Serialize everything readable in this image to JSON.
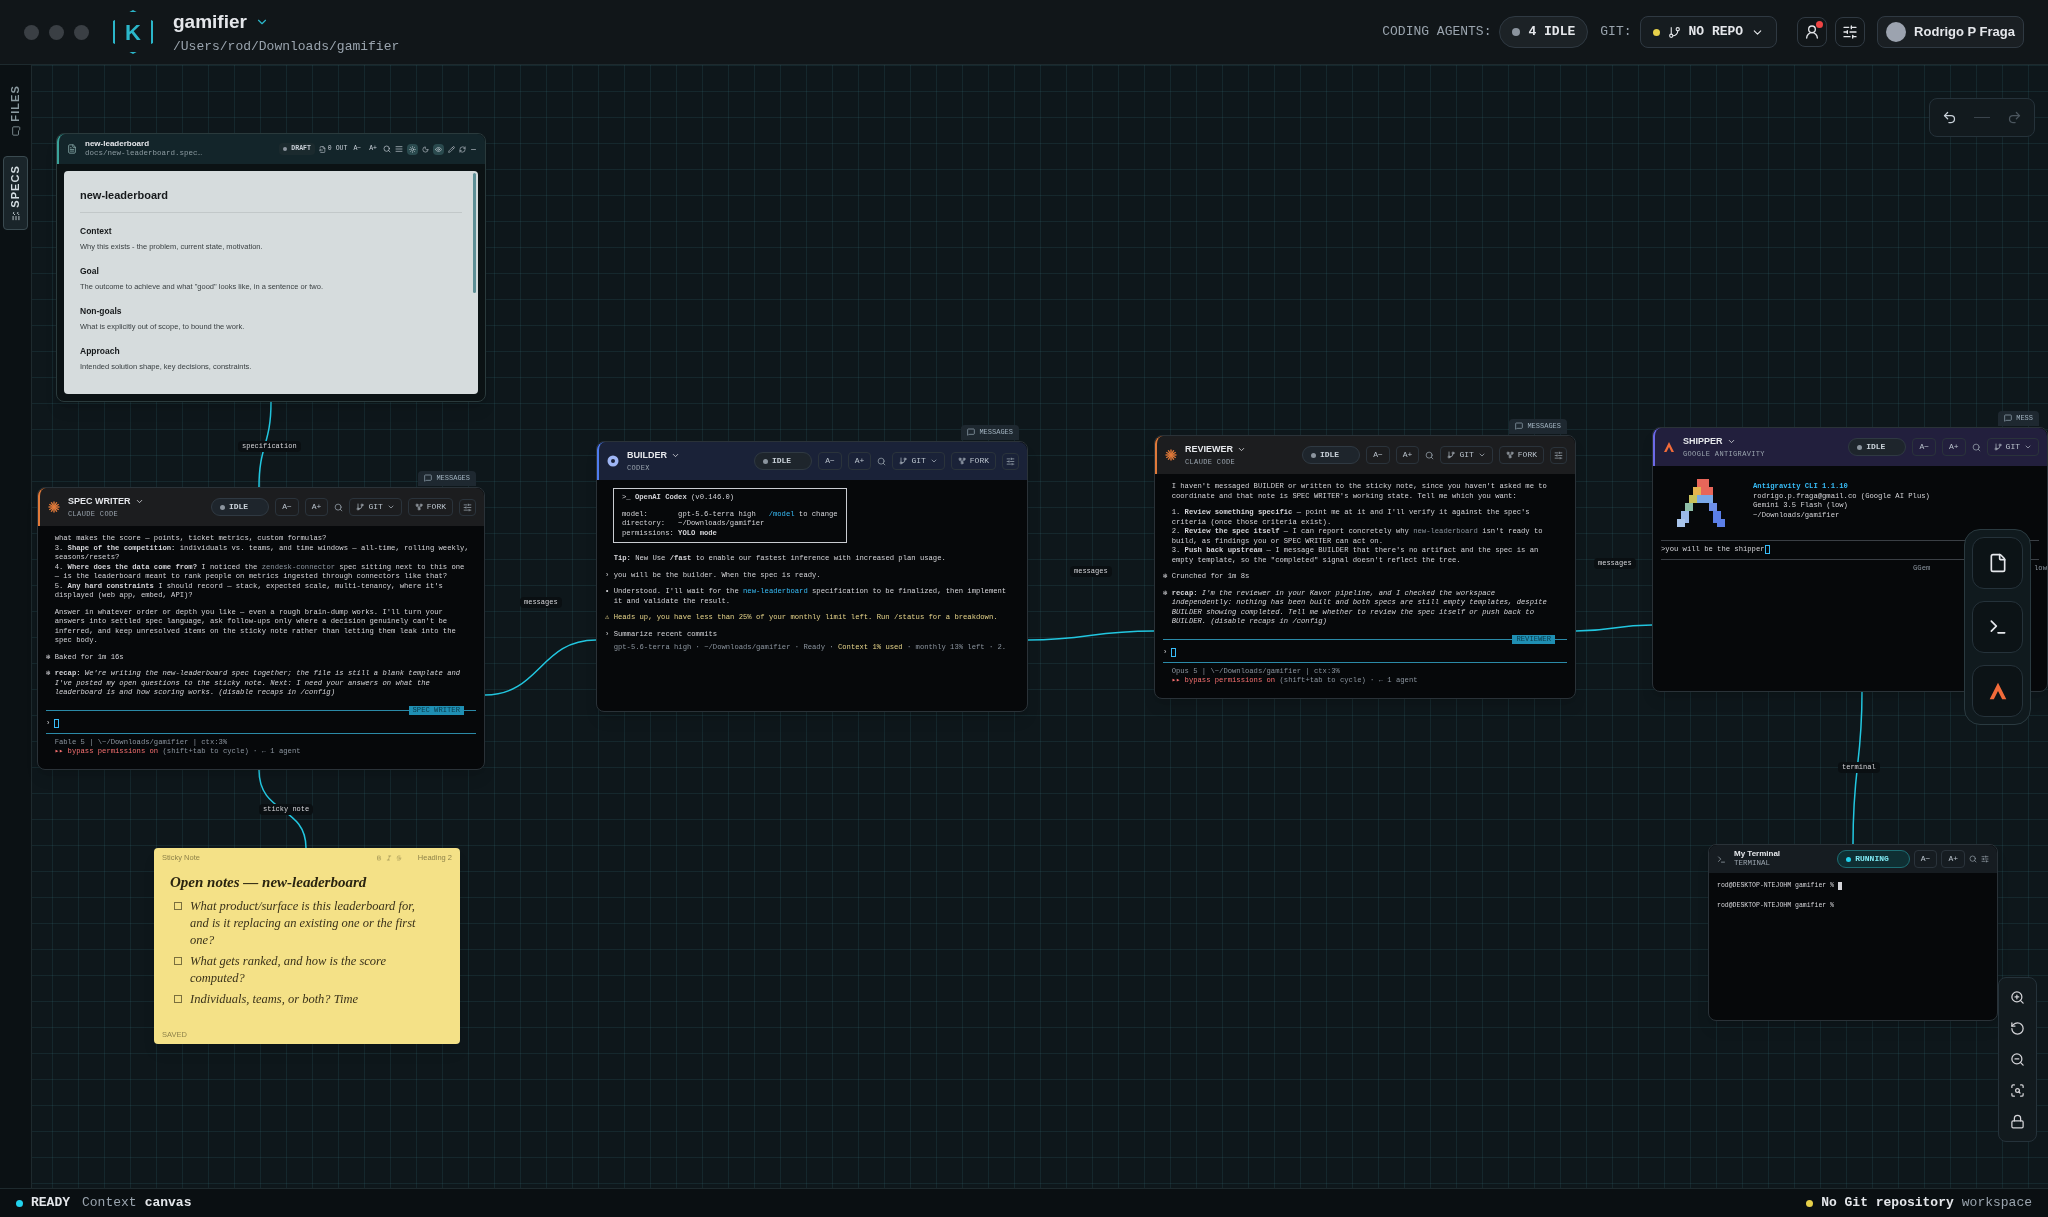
{
  "app": {
    "logo_letter": "K",
    "name": "gamifier",
    "path": "/Users/rod/Downloads/gamifier"
  },
  "header": {
    "agents_label": "CODING AGENTS:",
    "agents_status": "4 IDLE",
    "git_label": "GIT:",
    "git_status": "NO REPO",
    "alert": true,
    "user": "Rodrigo P Fraga"
  },
  "rail": [
    {
      "label": "FILES",
      "selected": false
    },
    {
      "label": "SPECS",
      "selected": true
    }
  ],
  "doc": {
    "title": "new-leaderboard",
    "path": "docs/new-leaderboard.spec…",
    "status": "DRAFT",
    "out": "0 OUT",
    "font_down": "A−",
    "font_up": "A+",
    "heading": "new-leaderboard",
    "sections": [
      {
        "heading": "Context",
        "body": "Why this exists - the problem, current state, motivation."
      },
      {
        "heading": "Goal",
        "body": "The outcome to achieve and what \"good\" looks like, in a sentence or two."
      },
      {
        "heading": "Non-goals",
        "body": "What is explicitly out of scope, to bound the work."
      },
      {
        "heading": "Approach",
        "body": "Intended solution shape, key decisions, constraints."
      }
    ]
  },
  "edges": [
    {
      "label": "specification"
    },
    {
      "label": "messages"
    },
    {
      "label": "messages"
    },
    {
      "label": "messages"
    },
    {
      "label": "sticky note"
    },
    {
      "label": "terminal"
    }
  ],
  "agents": [
    {
      "kind": "claude",
      "name": "SPEC WRITER",
      "subtitle": "CLAUDE CODE",
      "messages": "MESSAGES",
      "status": "IDLE",
      "running": false,
      "font_down": "A−",
      "font_up": "A+",
      "git": "GIT",
      "fork": "FORK",
      "lines": [
        {
          "text": "  what makes the score — points, ticket metrics, custom formulas?"
        },
        {
          "text": "  3. **Shape of the competition:** individuals vs. teams, and time windows — all-time, rolling weekly,"
        },
        {
          "text": "  seasons/resets?"
        },
        {
          "spans": [
            {
              "text": "  4. **Where does the data come from?** I noticed the ",
              "kind": "normal"
            },
            {
              "text": "zendesk-connector",
              "kind": "dim"
            },
            {
              "text": " spec sitting next to this one",
              "kind": "normal"
            }
          ]
        },
        {
          "text": "  — is the leaderboard meant to rank people on metrics ingested through connectors like that?"
        },
        {
          "text": "  5. **Any hard constraints** I should record — stack, expected scale, multi-tenancy, where it's"
        },
        {
          "text": "  displayed (web app, embed, API)?"
        },
        {
          "text": "  Answer in whatever order or depth you like — even a rough brain-dump works. I'll turn your",
          "gap": true
        },
        {
          "text": "  answers into settled spec language, ask follow-ups only where a decision genuinely can't be"
        },
        {
          "text": "  inferred, and keep unresolved items on the sticky note rather than letting them leak into the"
        },
        {
          "text": "  spec body."
        },
        {
          "text": "✻ Baked for 1m 16s",
          "gap": true
        },
        {
          "text": "✻ **recap:** *We're writing the new-leaderboard spec together; the file is still a blank template and*",
          "gap": true
        },
        {
          "text": "  *I've posted my open questions to the sticky note. Next: I need your answers on what the*"
        },
        {
          "text": "  *leaderboard is and how scoring works. (disable recaps in /config)*"
        }
      ],
      "prompt": "›",
      "tag": "SPEC WRITER",
      "footer": [
        {
          "spans": [
            {
              "text": "  Fable 5 | \\~/Downloads/gamifier | ctx:3%",
              "kind": "dim"
            }
          ]
        },
        {
          "spans": [
            {
              "text": "  ▸▸ bypass permissions on",
              "kind": "red"
            },
            {
              "text": " (shift+tab to cycle) · ← 1 agent",
              "kind": "dim"
            }
          ]
        }
      ]
    },
    {
      "kind": "codex",
      "name": "BUILDER",
      "subtitle": "CODEX",
      "messages": "MESSAGES",
      "status": "IDLE",
      "running": false,
      "font_down": "A−",
      "font_up": "A+",
      "git": "GIT",
      "fork": "FORK",
      "box": [
        {
          "text": ">_ **OpenAI Codex** (v0.146.0)"
        },
        {
          "spans": [
            {
              "text": "model:       gpt-5.6-terra high   ",
              "kind": "normal"
            },
            {
              "text": "/model",
              "kind": "link"
            },
            {
              "text": " to change",
              "kind": "normal"
            }
          ],
          "gap": true
        },
        {
          "text": "directory:   ~/Downloads/gamifier"
        },
        {
          "text": "permissions: **YOLO mode**"
        }
      ],
      "lines": [
        {
          "text": "  **Tip:** New Use **/fast** to enable our fastest inference with increased plan usage.",
          "gap": true
        },
        {
          "text": "› you will be the builder. When the spec is ready.",
          "gap": true
        },
        {
          "spans": [
            {
              "text": "• Understood. I'll wait for the ",
              "kind": "normal"
            },
            {
              "text": "new-leaderboard",
              "kind": "link"
            },
            {
              "text": " specification to be finalized, then implement",
              "kind": "normal"
            }
          ],
          "gap": true
        },
        {
          "text": "  it and validate the result."
        },
        {
          "spans": [
            {
              "text": "⚠ Heads up, you have less than 25% of your monthly limit left. Run /status for a breakdown.",
              "kind": "warn"
            }
          ],
          "gap": true
        },
        {
          "text": "› Summarize recent commits",
          "gap": true
        }
      ],
      "footer": [
        {
          "spans": [
            {
              "text": "  gpt-5.6-terra high · ~/Downloads/gamifier · Ready · ",
              "kind": "dim"
            },
            {
              "text": "Context 1% used",
              "kind": "warn"
            },
            {
              "text": " · monthly 13% left · 2.",
              "kind": "dim"
            }
          ]
        }
      ]
    },
    {
      "kind": "claude",
      "name": "REVIEWER",
      "subtitle": "CLAUDE CODE",
      "messages": "MESSAGES",
      "status": "IDLE",
      "running": false,
      "font_down": "A−",
      "font_up": "A+",
      "git": "GIT",
      "fork": "FORK",
      "lines": [
        {
          "text": "  I haven't messaged BUILDER or written to the sticky note, since you haven't asked me to"
        },
        {
          "text": "  coordinate and that note is SPEC WRITER's working state. Tell me which you want:"
        },
        {
          "text": "  1. **Review something specific** — point me at it and I'll verify it against the spec's",
          "gap": true
        },
        {
          "text": "  criteria (once those criteria exist)."
        },
        {
          "spans": [
            {
              "text": "  2. **Review the spec itself** — I can report concretely why ",
              "kind": "normal"
            },
            {
              "text": "new-leaderboard",
              "kind": "dim"
            },
            {
              "text": " isn't ready to",
              "kind": "normal"
            }
          ]
        },
        {
          "text": "  build, as findings you or SPEC WRITER can act on."
        },
        {
          "text": "  3. **Push back upstream** — I message BUILDER that there's no artifact and the spec is an"
        },
        {
          "text": "  empty template, so the \"completed\" signal doesn't reflect the tree."
        },
        {
          "text": "✻ Crunched for 1m 8s",
          "gap": true
        },
        {
          "text": "✻ **recap:** *I'm the reviewer in your Kavor pipeline, and I checked the workspace*",
          "gap": true
        },
        {
          "text": "  *independently: nothing has been built and both specs are still empty templates, despite*"
        },
        {
          "text": "  *BUILDER showing completed. Tell me whether to review the spec itself or push back to*"
        },
        {
          "text": "  *BUILDER. (disable recaps in /config)*"
        }
      ],
      "prompt": "›",
      "tag": "REVIEWER",
      "footer": [
        {
          "spans": [
            {
              "text": "  Opus 5 | \\~/Downloads/gamifier | ctx:3%",
              "kind": "dim"
            }
          ]
        },
        {
          "spans": [
            {
              "text": "  ▸▸ bypass permissions on",
              "kind": "red"
            },
            {
              "text": " (shift+tab to cycle) · ← 1 agent",
              "kind": "dim"
            }
          ]
        }
      ]
    },
    {
      "kind": "antigravity",
      "name": "SHIPPER",
      "subtitle": "GOOGLE ANTIGRAVITY",
      "messages": "MESS",
      "status": "IDLE",
      "running": false,
      "font_down": "A−",
      "font_up": "A+",
      "git": "GIT",
      "banner": [
        {
          "spans": [
            {
              "text": "**Antigravity CLI 1.1.10**",
              "kind": "link"
            }
          ]
        },
        {
          "text": "rodrigo.p.fraga@gmail.co (Google AI Plus)"
        },
        {
          "text": "Gemini 3.5 Flash (low)"
        },
        {
          "text": "~/Downloads/gamifier"
        }
      ],
      "input": ">you will be the shipper",
      "fragments": [
        "GGem",
        "low"
      ]
    }
  ],
  "terminal": {
    "title": "My Terminal",
    "subtitle": "TERMINAL",
    "status": "RUNNING",
    "running": true,
    "font_down": "A−",
    "font_up": "A+",
    "lines": [
      {
        "text": "rod@DESKTOP-NTEJOHM gamifier % ",
        "cursor": true
      },
      {
        "text": "rod@DESKTOP-NTEJOHM gamifier %",
        "cursor": false
      }
    ]
  },
  "sticky": {
    "label": "Sticky Note",
    "style": "Heading 2",
    "title": "Open notes — new-leaderboard",
    "items": [
      {
        "text": "What product/surface is this leaderboard for, and is it replacing an existing one or the first one?",
        "checked": false
      },
      {
        "text": "What gets ranked, and how is the score computed?",
        "checked": false
      },
      {
        "text": "Individuals, teams, or both? Time",
        "checked": false
      }
    ],
    "saved": "SAVED"
  },
  "status_bar": {
    "state": "READY",
    "context_label": "Context",
    "context": "canvas",
    "git": "No Git repository",
    "scope": "workspace"
  }
}
